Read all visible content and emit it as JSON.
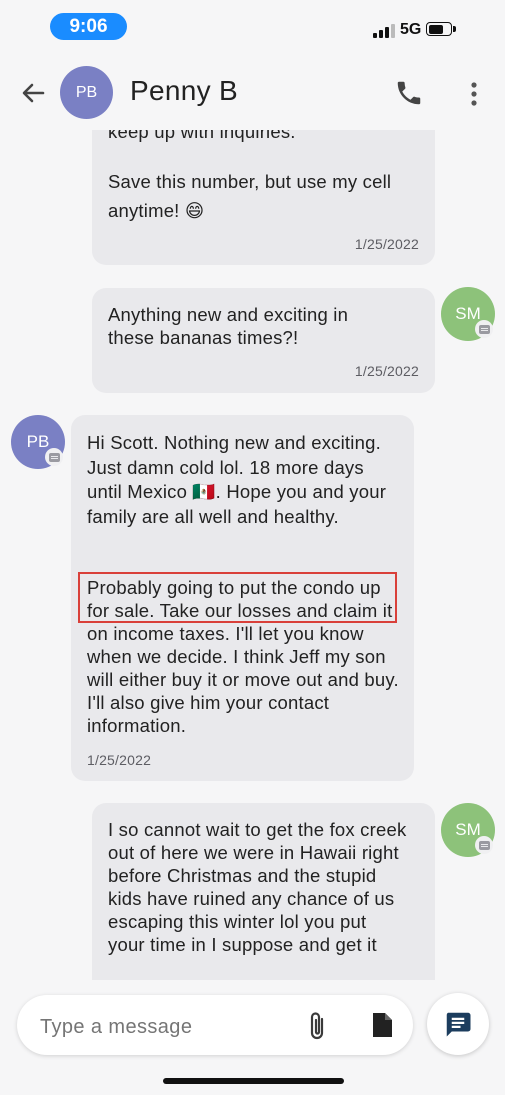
{
  "status_bar": {
    "time": "9:06",
    "network": "5G"
  },
  "header": {
    "avatar_initials": "PB",
    "contact_name": "Penny B"
  },
  "messages": [
    {
      "sender": "PB",
      "paragraphs": [
        "keep up with inquiries.",
        "Save this number, but use my cell anytime! 😄"
      ],
      "date": "1/25/2022"
    },
    {
      "sender": "SM",
      "avatar_initials": "SM",
      "paragraphs": [
        "Anything new and exciting in these bananas times?!"
      ],
      "date": "1/25/2022"
    },
    {
      "sender": "PB",
      "avatar_initials": "PB",
      "paragraphs": [
        "Hi Scott. Nothing new and exciting. Just damn cold lol. 18 more days until Mexico 🇲🇽. Hope you and your family are all well and healthy.",
        "Probably going to put the condo up for sale. Take our losses and claim it on income taxes. I'll let you know when we decide. I think Jeff my son will either buy it or move out and buy. I'll also give him your contact information."
      ],
      "date": "1/25/2022"
    },
    {
      "sender": "SM",
      "avatar_initials": "SM",
      "paragraphs": [
        "I so cannot wait to get the fox creek out of here we were in Hawaii right before Christmas and the stupid kids have ruined any chance of us escaping this winter lol you put your time in I suppose and get it"
      ],
      "date": ""
    }
  ],
  "compose": {
    "placeholder": "Type a message"
  },
  "colors": {
    "accent": "#1a8cff",
    "pb_avatar": "#7a80c4",
    "sm_avatar": "#8dc27a",
    "highlight": "#d9403a",
    "send_icon": "#1c3d5e"
  }
}
